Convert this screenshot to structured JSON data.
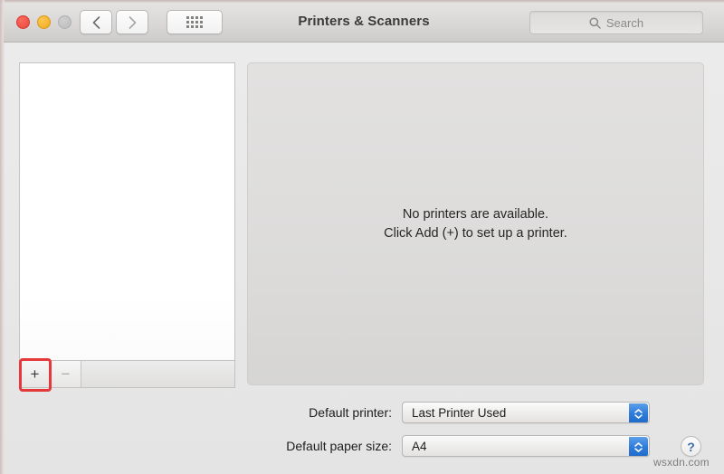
{
  "window": {
    "title": "Printers & Scanners",
    "traffic_lights": [
      {
        "name": "close",
        "color": "#e8483c"
      },
      {
        "name": "minimize",
        "color": "#f0ab1d"
      },
      {
        "name": "zoom",
        "color": "#bcbcbc"
      }
    ],
    "nav": {
      "back_icon": "chevron-left-icon",
      "forward_icon": "chevron-right-icon",
      "show_all_icon": "grid-icon"
    },
    "search": {
      "icon": "search-icon",
      "placeholder": "Search",
      "value": ""
    }
  },
  "printer_list": {
    "items": [],
    "add_label": "+",
    "remove_label": "−",
    "add_highlight_color": "#e4383a"
  },
  "content": {
    "empty_line_1": "No printers are available.",
    "empty_line_2": "Click Add (+) to set up a printer."
  },
  "settings": {
    "default_printer": {
      "label": "Default printer:",
      "value": "Last Printer Used"
    },
    "default_paper_size": {
      "label": "Default paper size:",
      "value": "A4"
    }
  },
  "help": {
    "label": "?",
    "icon": "question-mark-icon"
  },
  "watermark": {
    "text": "wsxdn.com"
  }
}
